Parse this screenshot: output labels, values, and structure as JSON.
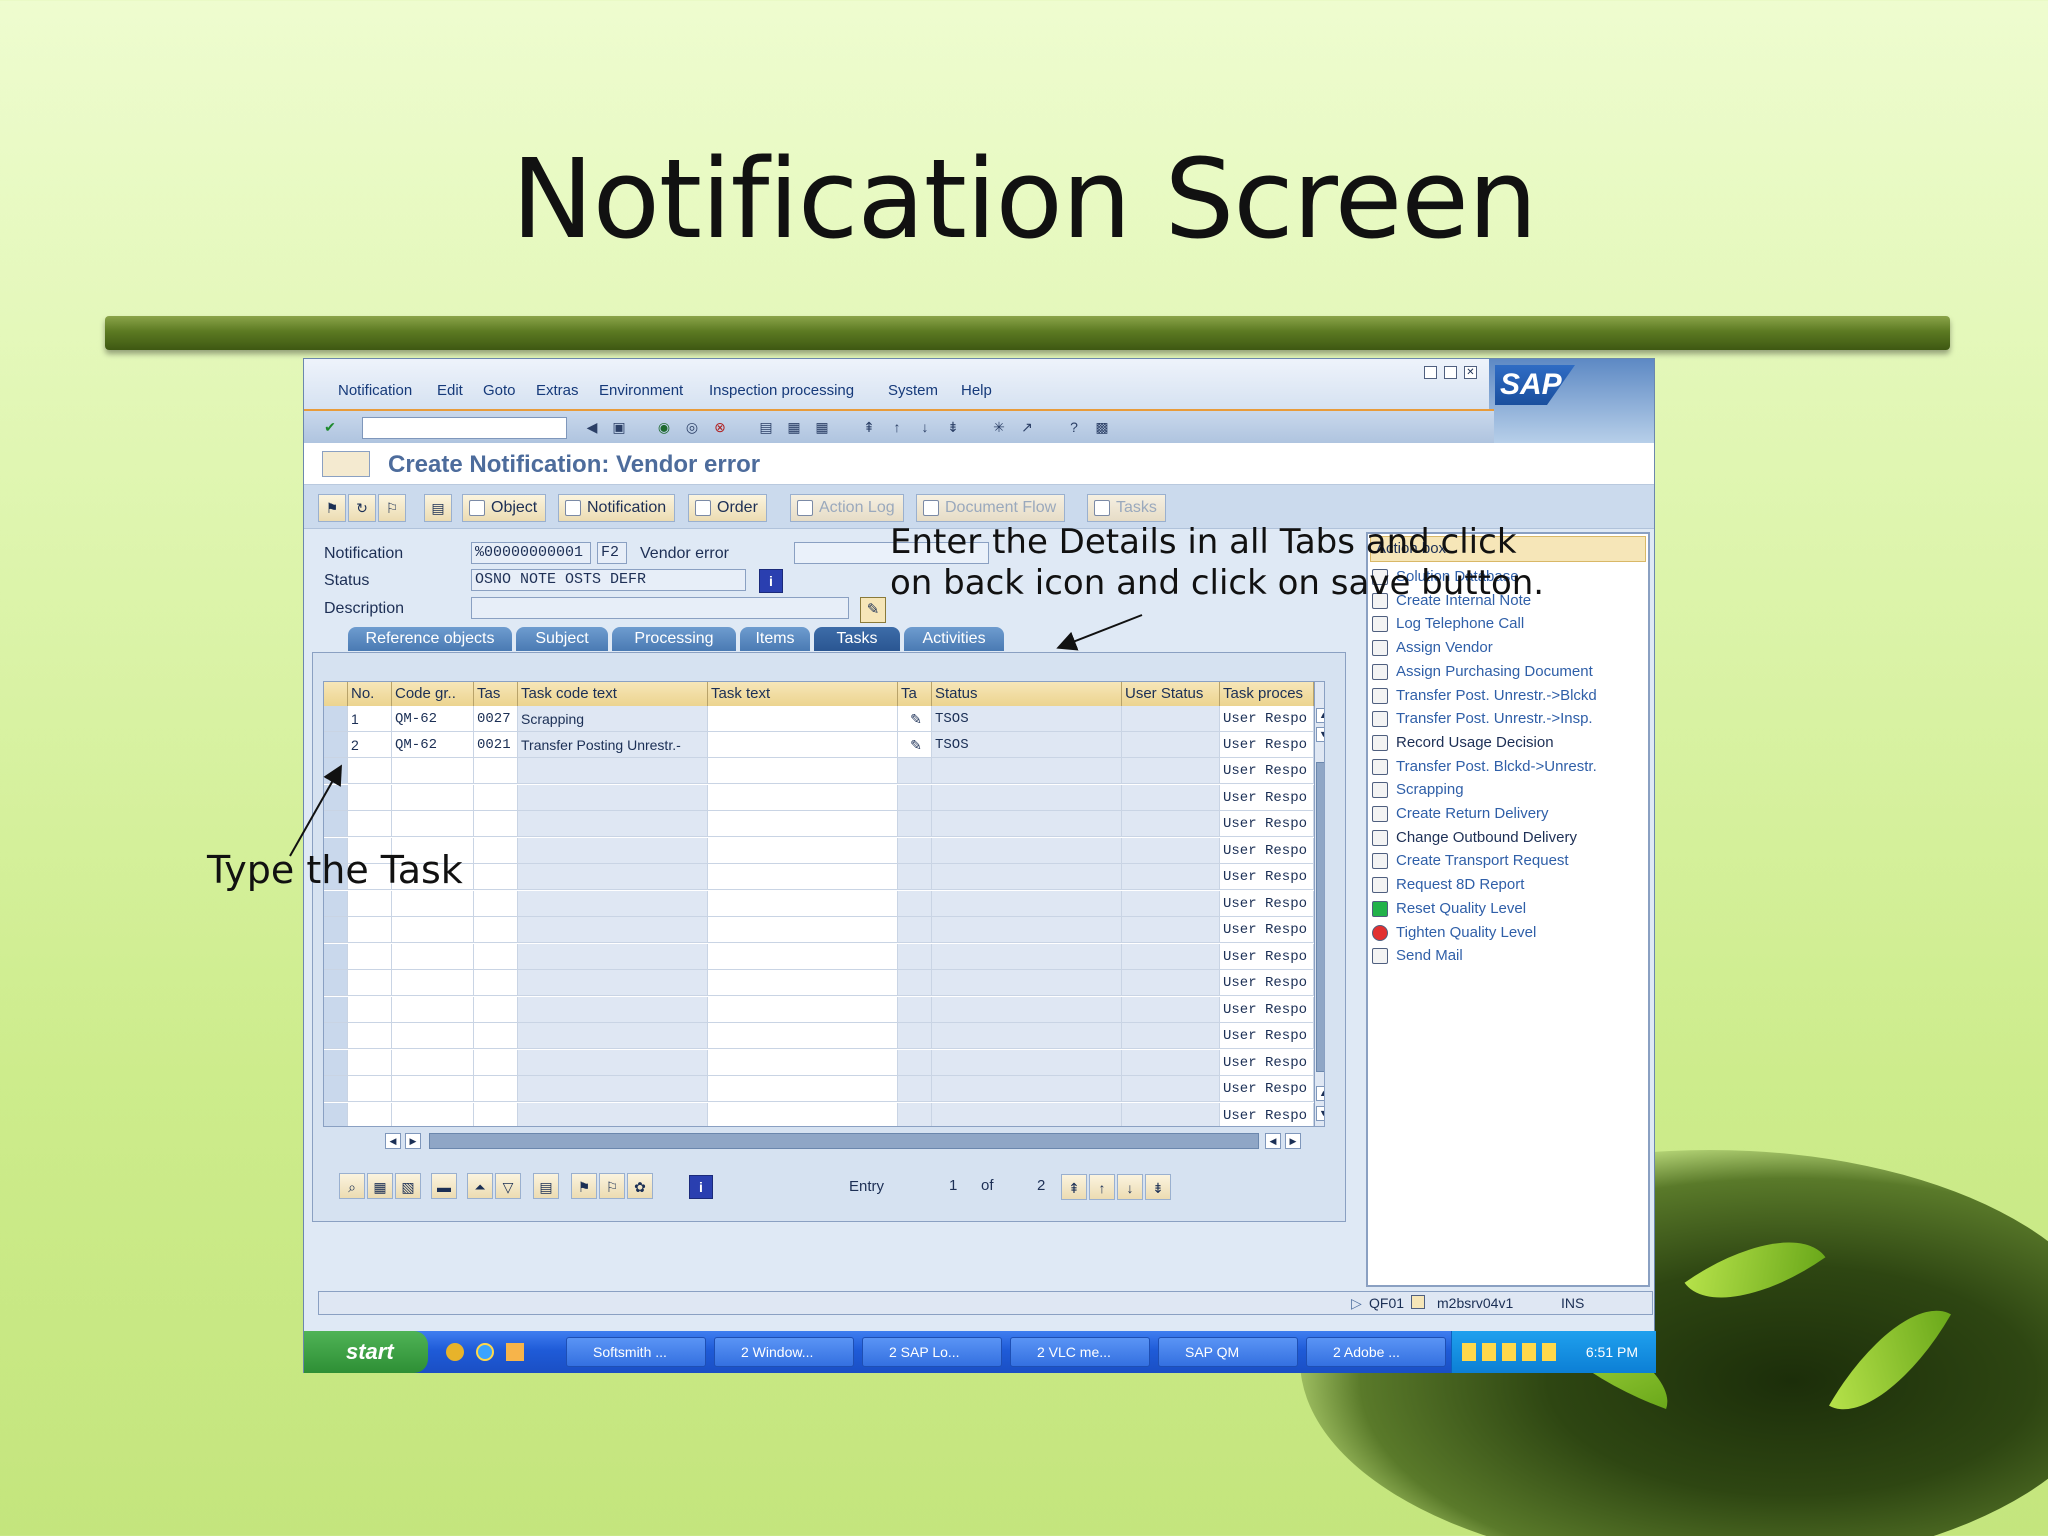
{
  "slide": {
    "title": "Notification Screen",
    "annotation_details": [
      "Enter the Details in all Tabs and click",
      "on back icon and click on save button."
    ],
    "annotation_task": "Type the Task"
  },
  "menu": [
    "Notification",
    "Edit",
    "Goto",
    "Extras",
    "Environment",
    "Inspection processing",
    "System",
    "Help"
  ],
  "screen_title": "Create Notification: Vendor error",
  "app_toolbar": {
    "object_label": "Object",
    "notification_label": "Notification",
    "order_label": "Order",
    "action_log_label": "Action Log",
    "document_flow_label": "Document Flow",
    "tasks_label": "Tasks"
  },
  "header_fields": {
    "notification_label": "Notification",
    "notification_value": "%00000000001",
    "notification_type": "F2",
    "notification_type_text": "Vendor error",
    "status_label": "Status",
    "status_value": "OSNO NOTE OSTS DEFR",
    "description_label": "Description",
    "description_value": ""
  },
  "tabs": [
    "Reference objects",
    "Subject",
    "Processing",
    "Items",
    "Tasks",
    "Activities"
  ],
  "active_tab": "Tasks",
  "grid": {
    "columns": [
      "No.",
      "Code gr..",
      "Tas",
      "Task code text",
      "Task text",
      "Ta",
      "Status",
      "User Status",
      "Task proces"
    ],
    "rows": [
      {
        "no": "1",
        "code_group": "QM-62",
        "task": "0027",
        "task_code_text": "Scrapping",
        "task_text": "",
        "status": "TSOS",
        "user_status": "",
        "processor": "User Respo"
      },
      {
        "no": "2",
        "code_group": "QM-62",
        "task": "0021",
        "task_code_text": "Transfer Posting Unrestr.-",
        "task_text": "",
        "status": "TSOS",
        "user_status": "",
        "processor": "User Respo"
      }
    ],
    "empty_row_processor": "User Respo"
  },
  "entry": {
    "label": "Entry",
    "current": "1",
    "of_label": "of",
    "total": "2"
  },
  "action_box": {
    "title": "Action box",
    "items": [
      "Solution Database",
      "Create Internal Note",
      "Log Telephone Call",
      "Assign Vendor",
      "Assign Purchasing Document",
      "Transfer Post. Unrestr.->Blckd",
      "Transfer Post. Unrestr.->Insp.",
      "Record Usage Decision",
      "Transfer Post. Blckd->Unrestr.",
      "Scrapping",
      "Create Return Delivery",
      "Change Outbound Delivery",
      "Create Transport Request",
      "Request 8D Report",
      "Reset Quality Level",
      "Tighten Quality Level",
      "Send Mail"
    ]
  },
  "status_bar": {
    "transaction": "QF01",
    "server": "m2bsrv04v1",
    "mode": "INS"
  },
  "sap_logo": "SAP",
  "taskbar": {
    "start": "start",
    "items": [
      "Softsmith ...",
      "2 Window...",
      "2 SAP Lo...",
      "2 VLC me...",
      "SAP QM",
      "2 Adobe ..."
    ],
    "clock": "6:51 PM"
  },
  "colors": {
    "accent_tab": "#4a7ab3",
    "grid_header": "#ecd48f",
    "window_bg": "#dfe9f5",
    "taskbar": "#1f5bd8"
  }
}
